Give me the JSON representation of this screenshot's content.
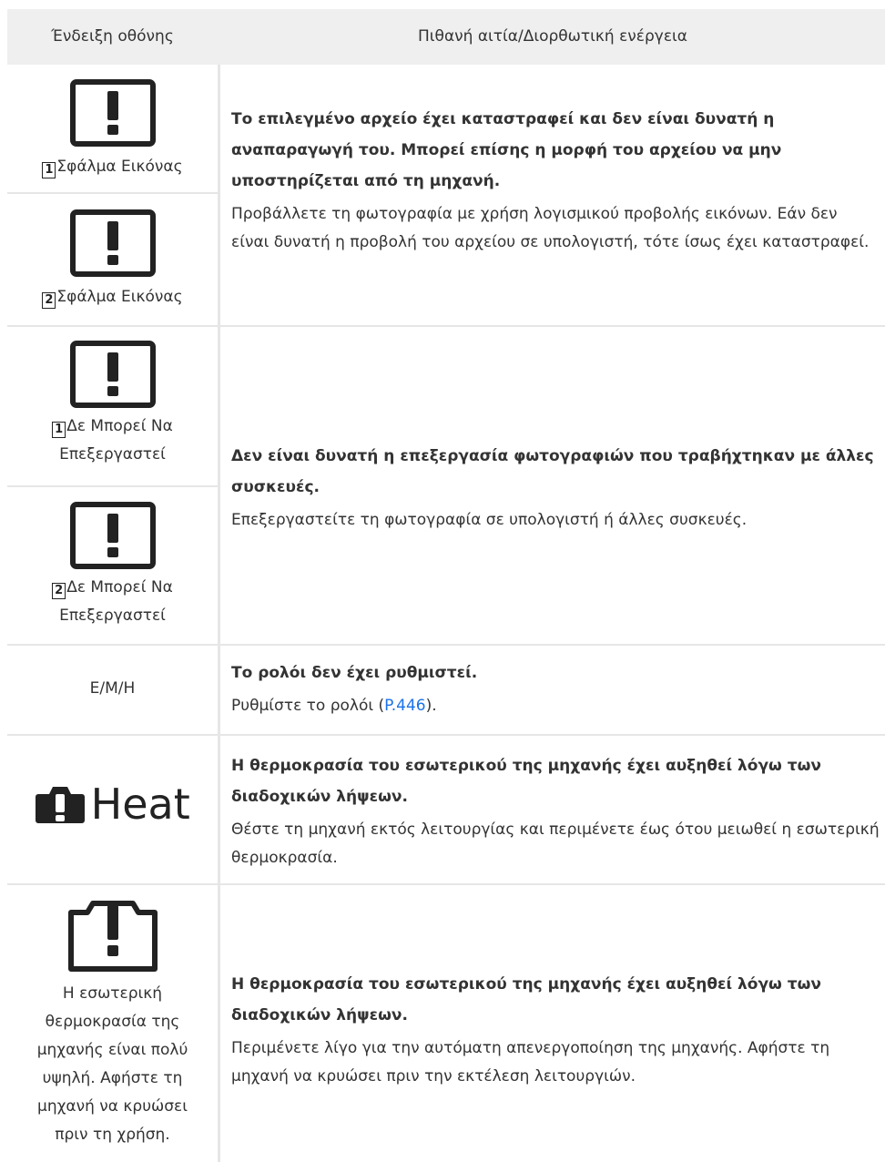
{
  "header": {
    "col1": "Ένδειξη οθόνης",
    "col2": "Πιθανή αιτία/Διορθωτική ενέργεια"
  },
  "rows": [
    {
      "left": [
        {
          "icon": "warning-box-icon",
          "badge": "1",
          "label": "Σφάλμα Εικόνας"
        },
        {
          "icon": "warning-box-icon",
          "badge": "2",
          "label": "Σφάλμα Εικόνας"
        }
      ],
      "cause": "Το επιλεγμένο αρχείο έχει καταστραφεί και δεν είναι δυνατή η αναπαραγωγή του. Μπορεί επίσης η μορφή του αρχείου να μην υποστηρίζεται από τη μηχανή.",
      "action": "Προβάλλετε τη φωτογραφία με χρήση λογισμικού προβολής εικόνων. Εάν δεν είναι δυνατή η προβολή του αρχείου σε υπολογιστή, τότε ίσως έχει καταστραφεί."
    },
    {
      "left": [
        {
          "icon": "warning-box-icon",
          "badge": "1",
          "label_line1": "Δε Μπορεί Να",
          "label_line2": "Επεξεργαστεί"
        },
        {
          "icon": "warning-box-icon",
          "badge": "2",
          "label_line1": "Δε Μπορεί Να",
          "label_line2": "Επεξεργαστεί"
        }
      ],
      "cause": "Δεν είναι δυνατή η επεξεργασία φωτογραφιών που τραβήχτηκαν με άλλες συσκευές.",
      "action": "Επεξεργαστείτε τη φωτογραφία σε υπολογιστή ή άλλες συσκευές."
    },
    {
      "left_text": "Ε/Μ/Η",
      "cause": "Το ρολόι δεν έχει ρυθμιστεί.",
      "action_prefix": "Ρυθμίστε το ρολόι (",
      "action_link": "P.446",
      "action_suffix": ")."
    },
    {
      "icon": "camera-warning-icon",
      "heat_label": "Heat",
      "cause": "Η θερμοκρασία του εσωτερικού της μηχανής έχει αυξηθεί λόγω των διαδοχικών λήψεων.",
      "action": "Θέστε τη μηχανή εκτός λειτουργίας και περιμένετε έως ότου μειωθεί η εσωτερική θερμοκρασία."
    },
    {
      "icon": "camera-outline-warning-icon",
      "left_lines": [
        "Η εσωτερική",
        "θερμοκρασία της",
        "μηχανής είναι πολύ",
        "υψηλή. Αφήστε τη",
        "μηχανή να κρυώσει",
        "πριν τη χρήση."
      ],
      "cause": "Η θερμοκρασία του εσωτερικού της μηχανής έχει αυξηθεί λόγω των διαδοχικών λήψεων.",
      "action": "Περιμένετε λίγο για την αυτόματη απενεργοποίηση της μηχανής. Αφήστε τη μηχανή να κρυώσει πριν την εκτέλεση λειτουργιών."
    }
  ],
  "colors": {
    "header_bg": "#efefef",
    "border": "#e6e6e6",
    "link": "#1a73e8",
    "text": "#333333"
  }
}
